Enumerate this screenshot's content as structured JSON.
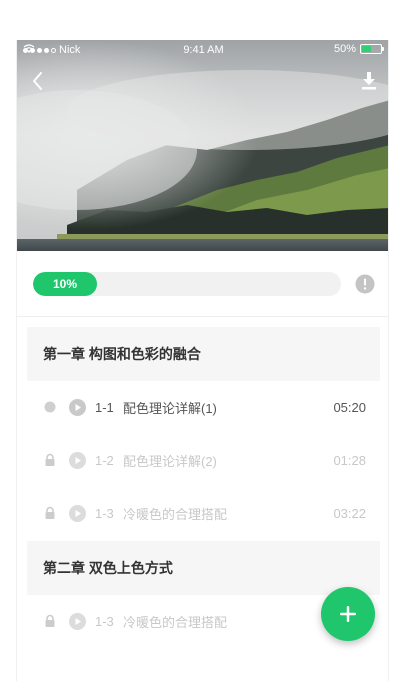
{
  "status_bar": {
    "carrier": "Nick",
    "time": "9:41 AM",
    "battery": "50%"
  },
  "header": {
    "back_icon": "chevron-left-icon",
    "download_icon": "download-icon"
  },
  "progress": {
    "label": "10%",
    "value_fraction": 0.1,
    "info_icon": "exclamation-circle-icon"
  },
  "chapters": [
    {
      "title": "第一章  构图和色彩的融合",
      "lessons": [
        {
          "num": "1-1",
          "title": "配色理论详解(1)",
          "duration": "05:20",
          "state": "active"
        },
        {
          "num": "1-2",
          "title": "配色理论详解(2)",
          "duration": "01:28",
          "state": "locked"
        },
        {
          "num": "1-3",
          "title": "冷暖色的合理搭配",
          "duration": "03:22",
          "state": "locked"
        }
      ]
    },
    {
      "title": "第二章  双色上色方式",
      "lessons": [
        {
          "num": "1-3",
          "title": "冷暖色的合理搭配",
          "duration": "",
          "state": "locked"
        }
      ]
    }
  ],
  "fab": {
    "icon": "plus-icon"
  },
  "colors": {
    "accent": "#1fc66c",
    "chapter_bg": "#f6f6f6",
    "locked_text": "#c8c8c8",
    "active_text": "#555555"
  }
}
